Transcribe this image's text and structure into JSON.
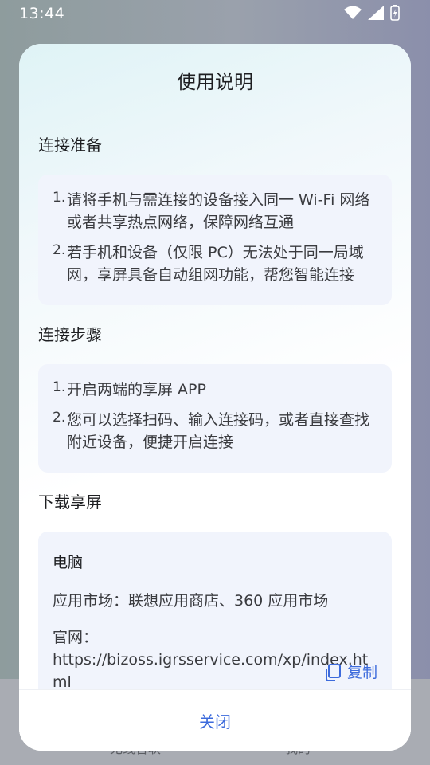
{
  "status": {
    "time": "13:44"
  },
  "background": {
    "tab_left": "无线音联",
    "tab_right": "我的"
  },
  "dialog": {
    "title": "使用说明",
    "sections": {
      "prep": {
        "title": "连接准备",
        "items": [
          {
            "num": "1.",
            "text": "请将手机与需连接的设备接入同一 Wi-Fi 网络或者共享热点网络，保障网络互通"
          },
          {
            "num": "2.",
            "text": "若手机和设备（仅限 PC）无法处于同一局域网，享屏具备自动组网功能，帮您智能连接"
          }
        ]
      },
      "steps": {
        "title": "连接步骤",
        "items": [
          {
            "num": "1.",
            "text": "开启两端的享屏 APP"
          },
          {
            "num": "2.",
            "text": "您可以选择扫码、输入连接码，或者直接查找附近设备，便捷开启连接"
          }
        ]
      },
      "download": {
        "title": "下载享屏",
        "card": {
          "heading": "电脑",
          "market": "应用市场：联想应用商店、360 应用市场",
          "site_label": "官网：",
          "url": "https://bizoss.igrsservice.com/xp/index.html",
          "copy_label": "复制"
        }
      }
    },
    "close_label": "关闭"
  }
}
